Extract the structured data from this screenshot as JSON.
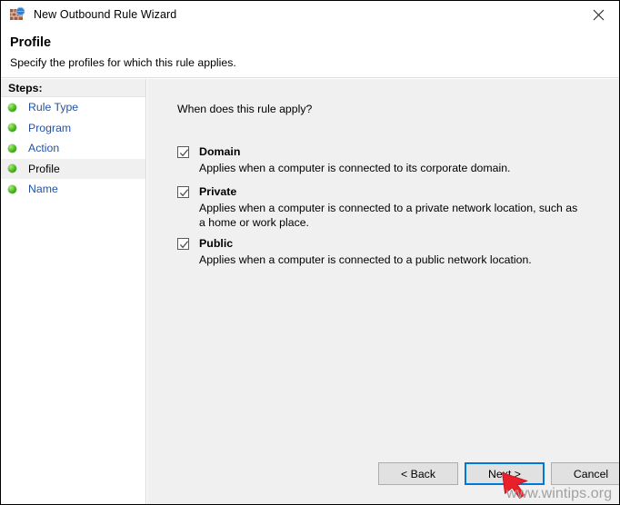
{
  "window": {
    "title": "New Outbound Rule Wizard",
    "title_icon": "firewall-globe-icon",
    "close_icon": "close-icon"
  },
  "header": {
    "title": "Profile",
    "subtitle": "Specify the profiles for which this rule applies."
  },
  "sidebar": {
    "heading": "Steps:",
    "items": [
      {
        "label": "Rule Type",
        "active": false
      },
      {
        "label": "Program",
        "active": false
      },
      {
        "label": "Action",
        "active": false
      },
      {
        "label": "Profile",
        "active": true
      },
      {
        "label": "Name",
        "active": false
      }
    ]
  },
  "main": {
    "question": "When does this rule apply?",
    "options": [
      {
        "label": "Domain",
        "checked": true,
        "description": "Applies when a computer is connected to its corporate domain."
      },
      {
        "label": "Private",
        "checked": true,
        "description": "Applies when a computer is connected to a private network location, such as a home or work place."
      },
      {
        "label": "Public",
        "checked": true,
        "description": "Applies when a computer is connected to a public network location."
      }
    ]
  },
  "buttons": {
    "back": "< Back",
    "next": "Next >",
    "cancel": "Cancel"
  },
  "overlay": {
    "watermark": "www.wintips.org",
    "cursor_icon": "red-arrow-cursor",
    "accent_focus": "#0078d7",
    "cursor_color": "#e8202a"
  }
}
